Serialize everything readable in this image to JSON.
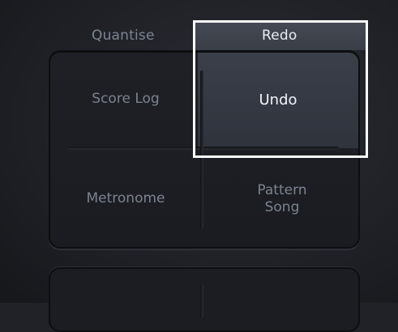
{
  "top_labels": {
    "quantise": "Quantise",
    "redo": "Redo"
  },
  "pads": {
    "score_log": "Score Log",
    "undo": "Undo",
    "metronome": "Metronome",
    "pattern_line1": "Pattern",
    "pattern_line2": "Song"
  },
  "colors": {
    "background": "#202228",
    "active_pad": "#3b3f4a",
    "highlight_border": "#ffffff",
    "inactive_text": "#7c8390",
    "active_text": "#f2f4f8"
  }
}
